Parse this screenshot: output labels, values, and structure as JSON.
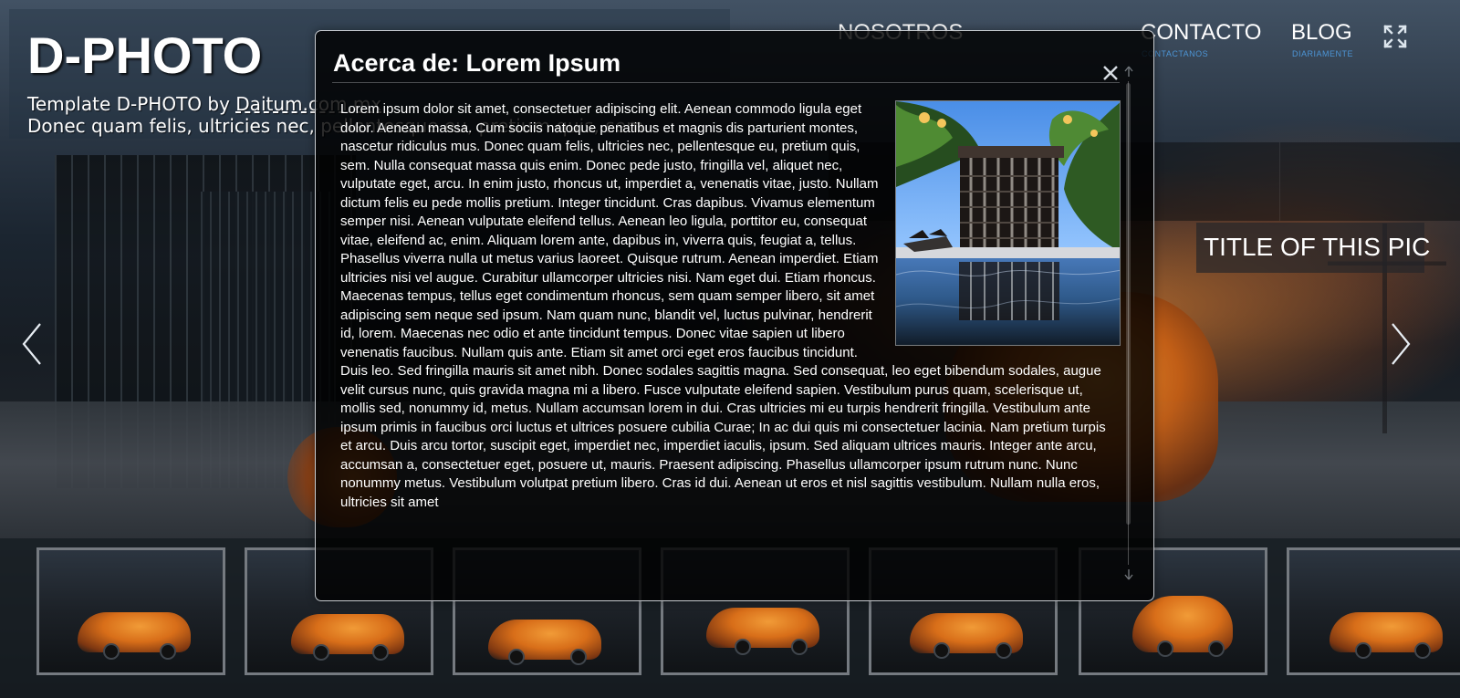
{
  "site": {
    "title": "D-PHOTO",
    "tagline_prefix": "Template D-PHOTO by ",
    "author": "Daitum.com.mx",
    "tagline_line2": "Donec quam felis, ultricies nec, pellentesque eu, pretium quis, sem."
  },
  "navigation": {
    "items": [
      {
        "label": "NOSOTROS",
        "sub": ""
      },
      {
        "label": "CONTACTO",
        "sub": "CONTACTANOS"
      },
      {
        "label": "BLOG",
        "sub": "DIARIAMENTE"
      }
    ]
  },
  "slider": {
    "photo_title": "TITLE OF THIS PIC"
  },
  "modal": {
    "title": "Acerca de: Lorem Ipsum",
    "body": "Lorem ipsum dolor sit amet, consectetuer adipiscing elit. Aenean commodo ligula eget dolor. Aenean massa. Cum sociis natoque penatibus et magnis dis parturient montes, nascetur ridiculus mus. Donec quam felis, ultricies nec, pellentesque eu, pretium quis, sem. Nulla consequat massa quis enim. Donec pede justo, fringilla vel, aliquet nec, vulputate eget, arcu. In enim justo, rhoncus ut, imperdiet a, venenatis vitae, justo. Nullam dictum felis eu pede mollis pretium. Integer tincidunt. Cras dapibus. Vivamus elementum semper nisi. Aenean vulputate eleifend tellus. Aenean leo ligula, porttitor eu, consequat vitae, eleifend ac, enim. Aliquam lorem ante, dapibus in, viverra quis, feugiat a, tellus. Phasellus viverra nulla ut metus varius laoreet. Quisque rutrum. Aenean imperdiet. Etiam ultricies nisi vel augue. Curabitur ullamcorper ultricies nisi. Nam eget dui. Etiam rhoncus. Maecenas tempus, tellus eget condimentum rhoncus, sem quam semper libero, sit amet adipiscing sem neque sed ipsum. Nam quam nunc, blandit vel, luctus pulvinar, hendrerit id, lorem. Maecenas nec odio et ante tincidunt tempus. Donec vitae sapien ut libero venenatis faucibus. Nullam quis ante. Etiam sit amet orci eget eros faucibus tincidunt. Duis leo. Sed fringilla mauris sit amet nibh. Donec sodales sagittis magna. Sed consequat, leo eget bibendum sodales, augue velit cursus nunc, quis gravida magna mi a libero. Fusce vulputate eleifend sapien. Vestibulum purus quam, scelerisque ut, mollis sed, nonummy id, metus. Nullam accumsan lorem in dui. Cras ultricies mi eu turpis hendrerit fringilla. Vestibulum ante ipsum primis in faucibus orci luctus et ultrices posuere cubilia Curae; In ac dui quis mi consectetuer lacinia. Nam pretium turpis et arcu. Duis arcu tortor, suscipit eget, imperdiet nec, imperdiet iaculis, ipsum. Sed aliquam ultrices mauris. Integer ante arcu, accumsan a, consectetuer eget, posuere ut, mauris. Praesent adipiscing. Phasellus ullamcorper ipsum rutrum nunc. Nunc nonummy metus. Vestibulum volutpat pretium libero. Cras id dui. Aenean ut eros et nisl sagittis vestibulum. Nullam nulla eros, ultricies sit amet"
  },
  "icons": {
    "fullscreen": "fullscreen-icon",
    "close": "close-icon",
    "prev": "chevron-left-icon",
    "next": "chevron-right-icon",
    "scroll_up": "arrow-up-icon",
    "scroll_down": "arrow-down-icon"
  },
  "colors": {
    "accent": "#4c95d6",
    "text": "#ffffff",
    "thumb_border": "#757a80"
  }
}
